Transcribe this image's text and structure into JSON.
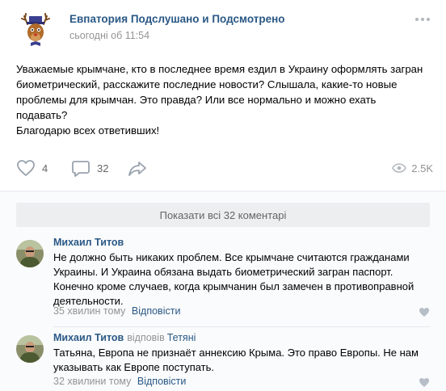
{
  "post": {
    "group_name": "Евпатория Подслушано и Подсмотрено",
    "time": "сьогодні об 11:54",
    "text_lines": [
      "Уважаемые крымчане, кто в последнее время ездил в Украину оформлять загран",
      "биометрический, расскажите последние новости? Слышала, какие-то новые",
      "проблемы для крымчан. Это правда? Или все нормально и можно ехать",
      "подавать?",
      "Благодарю всех ответивших!"
    ],
    "likes": "4",
    "comments": "32",
    "views": "2.5K",
    "icons": {
      "like": "heart-icon",
      "comment": "speech-bubble-icon",
      "share": "share-arrow-icon",
      "views": "eye-icon",
      "more": "more-dots-icon"
    }
  },
  "comments_block": {
    "show_all_label": "Показати всі 32 коментарі",
    "items": [
      {
        "author": "Михаил Титов",
        "replied_label": "",
        "reply_to": "",
        "text_lines": [
          "Не должно быть никаких проблем. Все крымчане считаются гражданами",
          "Украины. И Украина обязана выдать биометрический загран паспорт.",
          "Конечно кроме случаев, когда крымчанин был замечен в противоправной",
          "деятельности."
        ],
        "time": "35 хвилин тому",
        "reply_label": "Відповісти"
      },
      {
        "author": "Михаил Титов",
        "replied_label": "відповів",
        "reply_to": "Тетяні",
        "text_lines": [
          "Татьяна, Европа не признаёт аннексию Крыма. Это право Европы. Не нам",
          "указывать как Европе поступать."
        ],
        "time": "32 хвилини тому",
        "reply_label": "Відповісти"
      }
    ]
  },
  "colors": {
    "link": "#2a5885",
    "muted": "#939393",
    "icon": "#99a2ad",
    "background": "#edeef0"
  }
}
